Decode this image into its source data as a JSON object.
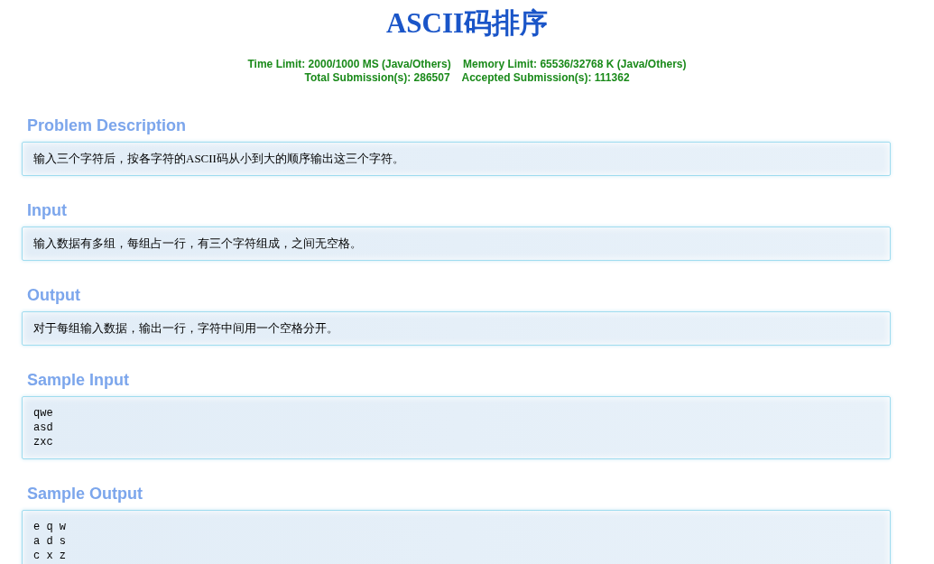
{
  "title": "ASCII码排序",
  "limits": [
    "Time Limit: 2000/1000 MS (Java/Others)    Memory Limit: 65536/32768 K (Java/Others)",
    "Total Submission(s): 286507    Accepted Submission(s): 111362"
  ],
  "sections": [
    {
      "heading": "Problem Description",
      "kind": "text",
      "body": "输入三个字符后，按各字符的ASCII码从小到大的顺序输出这三个字符。"
    },
    {
      "heading": "Input",
      "kind": "text",
      "body": "输入数据有多组，每组占一行，有三个字符组成，之间无空格。"
    },
    {
      "heading": "Output",
      "kind": "text",
      "body": "对于每组输入数据，输出一行，字符中间用一个空格分开。"
    },
    {
      "heading": "Sample Input",
      "kind": "code",
      "body": "qwe\nasd\nzxc"
    },
    {
      "heading": "Sample Output",
      "kind": "code",
      "body": "e q w\na d s\nc x z"
    }
  ]
}
